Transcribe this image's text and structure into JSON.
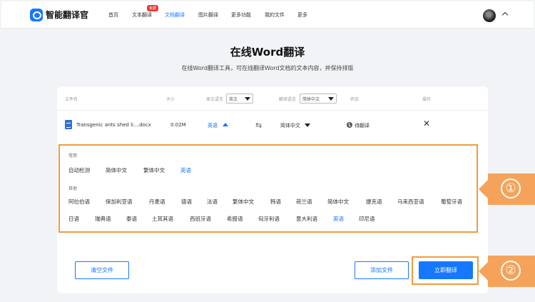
{
  "brand": "智能翻译官",
  "nav": {
    "items": [
      "首页",
      "文本翻译",
      "文档翻译",
      "图片翻译",
      "更多功能",
      "我的文件",
      "更多"
    ],
    "badge": "免费",
    "active_index": 2
  },
  "page": {
    "title": "在线Word翻译",
    "subtitle": "在线Word翻译工具，可在线翻译Word文档的文本内容，并保持排版"
  },
  "table": {
    "headers": {
      "filename": "文件名",
      "size": "大小",
      "source_lang": "原文语言",
      "source_select": "英文",
      "target_lang": "翻译语言",
      "target_select": "简体中文",
      "status": "状态",
      "action": "操作"
    },
    "row": {
      "filename": "Transgenic ants shed li...",
      "ext": ".docx",
      "size": "0.02M",
      "source": "英语",
      "target": "简体中文",
      "status": "待翻译"
    }
  },
  "languages": {
    "common_label": "常用",
    "common": [
      "自动检测",
      "简体中文",
      "繁体中文",
      "英语"
    ],
    "other_label": "其他",
    "other_row1": [
      "阿拉伯语",
      "保加利亚语",
      "丹麦语",
      "德语",
      "法语",
      "繁体中文",
      "韩语",
      "荷兰语",
      "简体中文",
      "捷克语",
      "马来西亚语",
      "葡萄牙语"
    ],
    "other_row2": [
      "日语",
      "瑞典语",
      "泰语",
      "土耳其语",
      "西班牙语",
      "希腊语",
      "匈牙利语",
      "意大利语",
      "英语",
      "印尼语"
    ],
    "selected": "英语"
  },
  "buttons": {
    "clear": "清空文件",
    "add": "添加文件",
    "translate": "立即翻译"
  },
  "callouts": [
    "①",
    "②"
  ],
  "colors": {
    "accent": "#1677ff",
    "highlight": "#f39a3d",
    "callout": "#f5a35a"
  }
}
